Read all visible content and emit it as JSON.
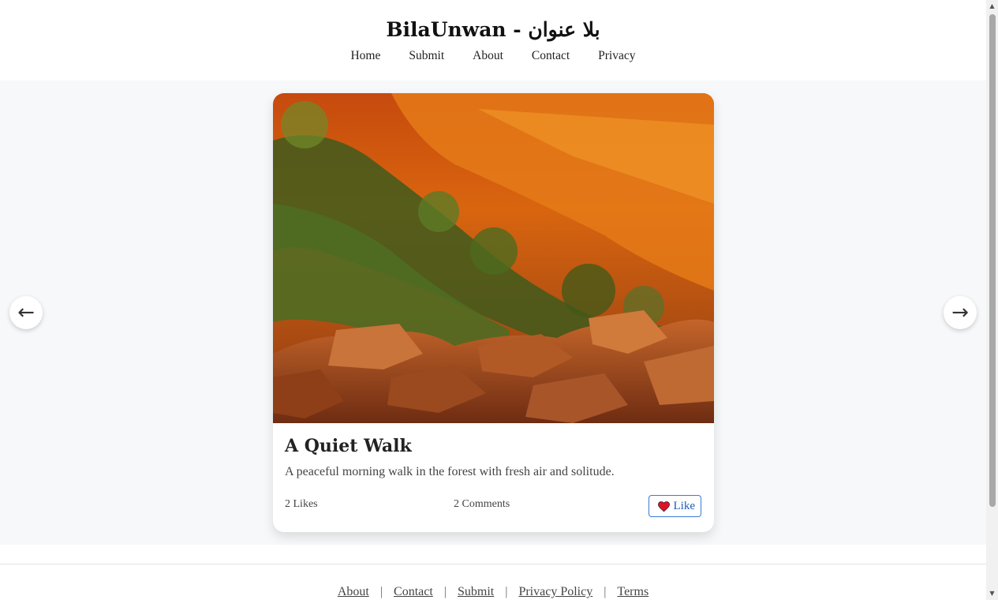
{
  "header": {
    "title": "BilaUnwan - بلا عنوان",
    "nav": [
      "Home",
      "Submit",
      "About",
      "Contact",
      "Privacy"
    ]
  },
  "carousel": {
    "prev_icon": "←",
    "next_icon": "→"
  },
  "post": {
    "image_alt": "rocky canyon landscape at sunset",
    "title": "A Quiet Walk",
    "description": "A peaceful morning walk in the forest with fresh air and solitude.",
    "likes": "2 Likes",
    "comments": "2 Comments",
    "like_label": "Like",
    "like_icon": "heart-icon",
    "like_color": "#e0102a"
  },
  "footer": {
    "links": [
      "About",
      "Contact",
      "Submit",
      "Privacy Policy",
      "Terms"
    ],
    "separator": "|"
  }
}
